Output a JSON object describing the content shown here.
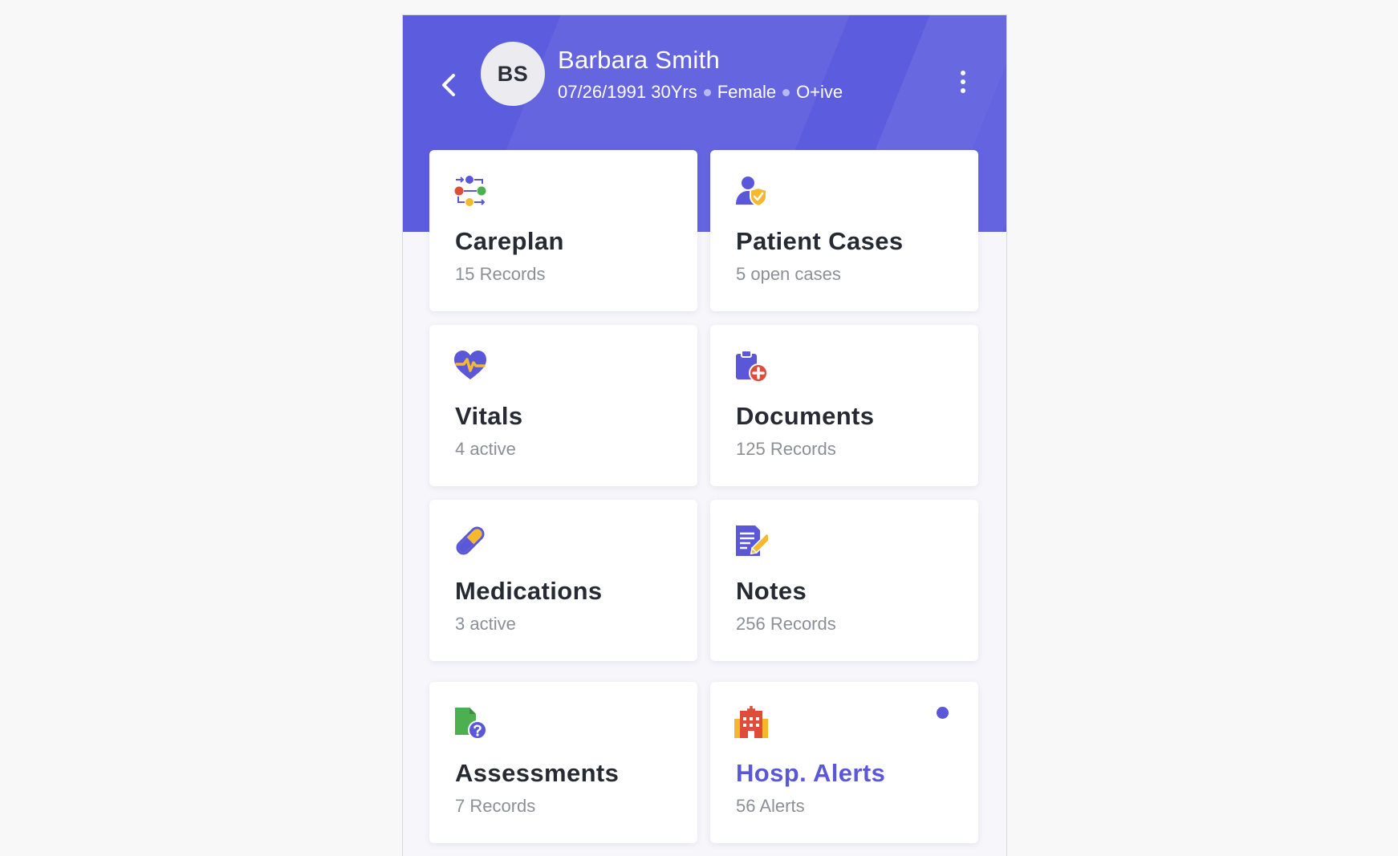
{
  "patient": {
    "initials": "BS",
    "name": "Barbara Smith",
    "dob_age": "07/26/1991 30Yrs",
    "gender": "Female",
    "blood_type": "O+ive"
  },
  "cards": [
    {
      "title": "Careplan",
      "subtitle": "15 Records",
      "icon": "careplan-flow-icon"
    },
    {
      "title": "Patient Cases",
      "subtitle": "5 open cases",
      "icon": "patient-shield-icon"
    },
    {
      "title": "Vitals",
      "subtitle": "4 active",
      "icon": "heart-pulse-icon"
    },
    {
      "title": "Documents",
      "subtitle": "125 Records",
      "icon": "clipboard-plus-icon"
    },
    {
      "title": "Medications",
      "subtitle": "3 active",
      "icon": "pill-capsule-icon"
    },
    {
      "title": "Notes",
      "subtitle": "256 Records",
      "icon": "note-pencil-icon"
    },
    {
      "title": "Assessments",
      "subtitle": "7 Records",
      "icon": "document-question-icon"
    },
    {
      "title": "Hosp. Alerts",
      "subtitle": "56 Alerts",
      "icon": "hospital-building-icon",
      "unread": true
    }
  ],
  "colors": {
    "header": "#5c5cdf",
    "accent": "#5a57d9",
    "card_title": "#252a33",
    "card_subtitle": "#8c8f96",
    "background": "#f6f6fb"
  }
}
